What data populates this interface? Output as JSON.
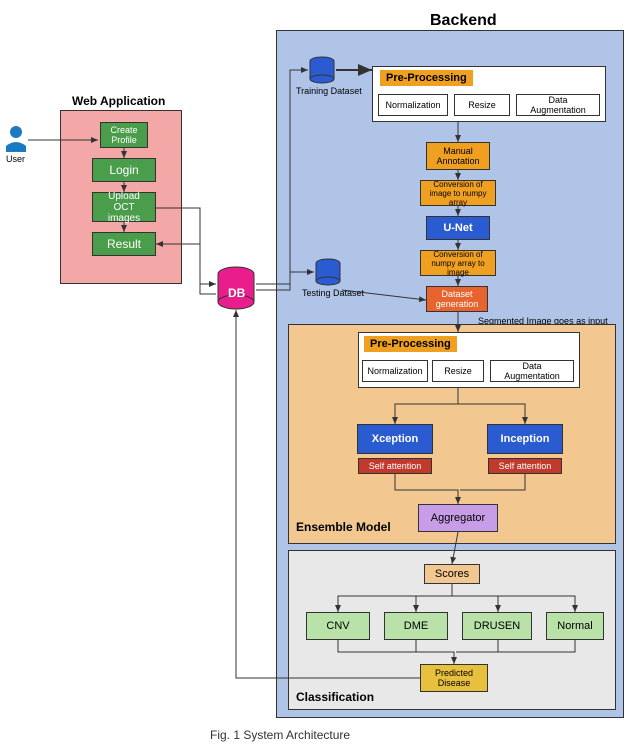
{
  "title_backend": "Backend",
  "title_web": "Web Application",
  "user_label": "User",
  "db_label": "DB",
  "training_dataset": "Training Dataset",
  "testing_dataset": "Testing Dataset",
  "webapp": {
    "create_profile": "Create Profile",
    "login": "Login",
    "upload": "Upload OCT images",
    "result": "Result"
  },
  "preproc1": {
    "title": "Pre-Processing",
    "norm": "Normalization",
    "resize": "Resize",
    "aug": "Data Augmentation"
  },
  "mid": {
    "manual": "Manual Annotation",
    "conv_to_np": "Conversion of image to numpy array",
    "unet": "U-Net",
    "conv_to_img": "Conversion of numpy array to image",
    "dataset_gen": "Dataset generation"
  },
  "seg_note": "Segmented Image goes as input",
  "ensemble": {
    "title": "Ensemble Model",
    "preproc": {
      "title": "Pre-Processing",
      "norm": "Normalization",
      "resize": "Resize",
      "aug": "Data Augmentation"
    },
    "xception": "Xception",
    "inception": "Inception",
    "self_att1": "Self attention",
    "self_att2": "Self attention",
    "aggregator": "Aggregator"
  },
  "classification": {
    "title": "Classification",
    "scores": "Scores",
    "cnv": "CNV",
    "dme": "DME",
    "drusen": "DRUSEN",
    "normal": "Normal",
    "predicted": "Predicted Disease"
  },
  "caption": "Fig. 1 System Architecture"
}
